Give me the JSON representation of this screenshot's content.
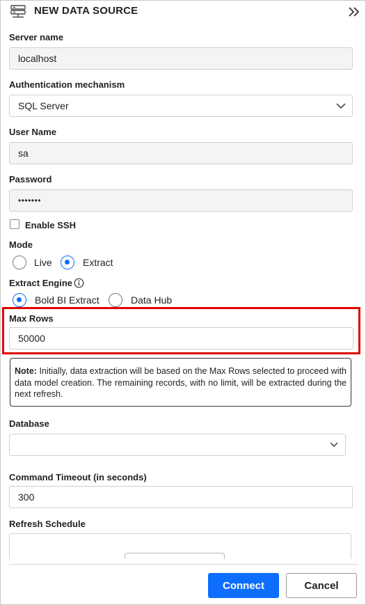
{
  "header": {
    "title": "NEW DATA SOURCE",
    "icon": "data-source-icon",
    "collapse_icon": "double-chevron-right-icon"
  },
  "server": {
    "label": "Server name",
    "value": "localhost"
  },
  "auth": {
    "label": "Authentication mechanism",
    "value": "SQL Server"
  },
  "user": {
    "label": "User Name",
    "value": "sa"
  },
  "password": {
    "label": "Password",
    "value": "•••••••"
  },
  "ssh": {
    "label": "Enable SSH",
    "checked": false
  },
  "mode": {
    "label": "Mode",
    "options": [
      {
        "label": "Live",
        "selected": false
      },
      {
        "label": "Extract",
        "selected": true
      }
    ]
  },
  "engine": {
    "label": "Extract Engine",
    "info_icon": "info-icon",
    "options": [
      {
        "label": "Bold BI Extract",
        "selected": true
      },
      {
        "label": "Data Hub",
        "selected": false
      }
    ]
  },
  "max_rows": {
    "label": "Max Rows",
    "value": "50000"
  },
  "note": {
    "prefix": "Note:",
    "text": "Initially, data extraction will be based on the Max Rows selected to proceed with data model creation. The remaining records, with no limit, will be extracted during the next refresh."
  },
  "database": {
    "label": "Database",
    "value": ""
  },
  "timeout": {
    "label": "Command Timeout (in seconds)",
    "value": "300"
  },
  "schedule": {
    "label": "Refresh Schedule"
  },
  "footer": {
    "connect_label": "Connect",
    "cancel_label": "Cancel"
  },
  "colors": {
    "accent": "#0d6efd",
    "highlight": "#e00000"
  }
}
